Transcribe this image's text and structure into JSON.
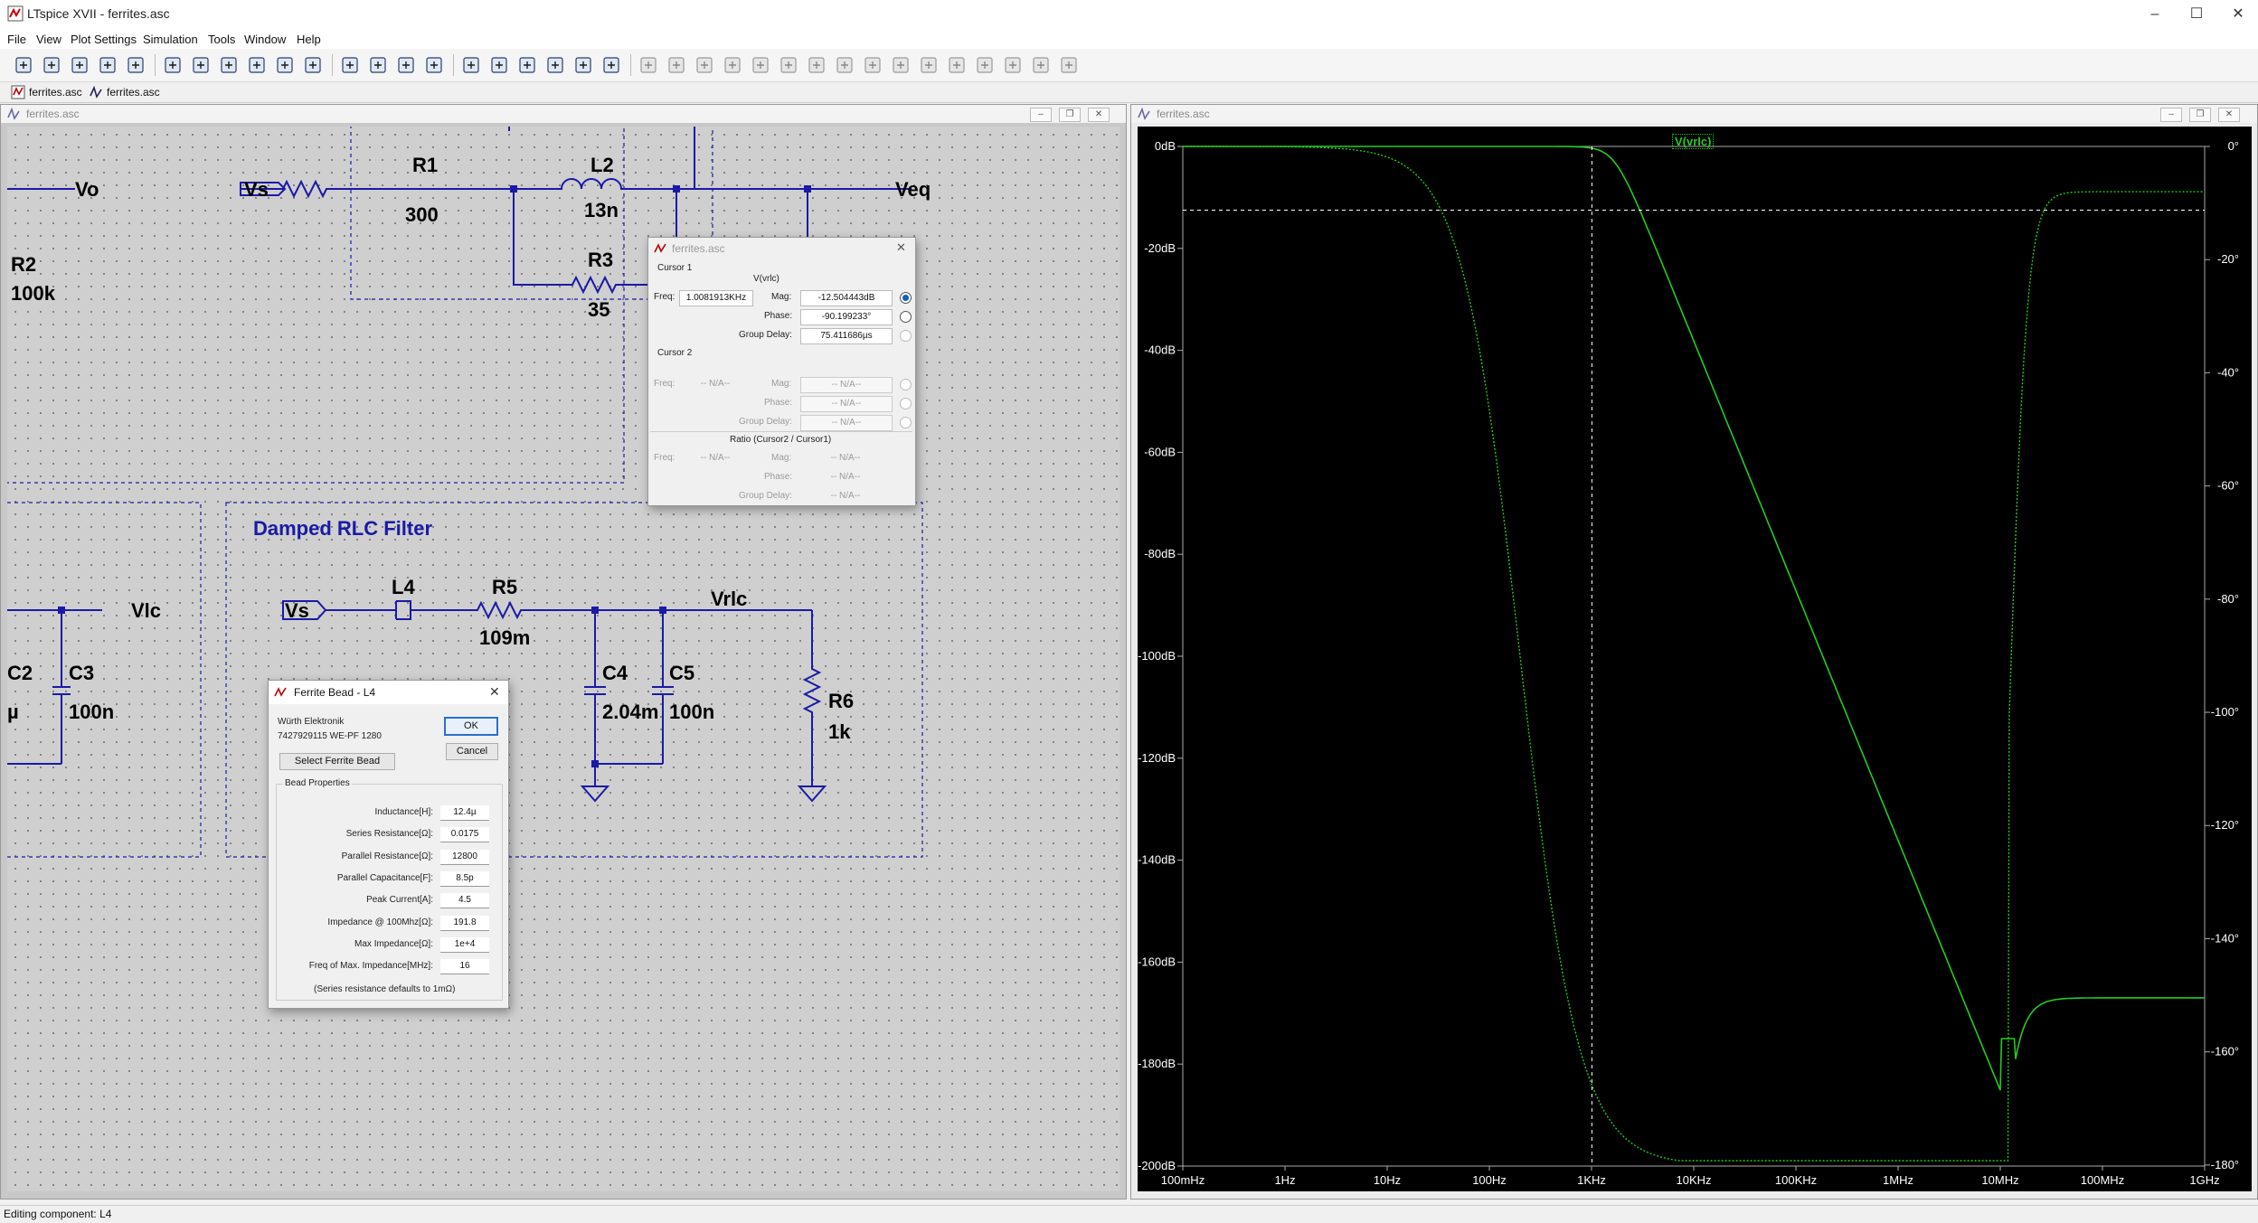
{
  "app": {
    "title": "LTspice XVII - ferrites.asc"
  },
  "window_controls": {
    "minimize": "–",
    "maximize": "☐",
    "close": "✕"
  },
  "menu": [
    "File",
    "View",
    "Plot Settings",
    "Simulation",
    "Tools",
    "Window",
    "Help"
  ],
  "toolbar_icons": [
    "run-icon",
    "open-icon",
    "save-icon",
    "control-panel-icon",
    "halt-icon",
    "pan-icon",
    "zoom-in-icon",
    "zoom-out-icon",
    "zoom-full-icon",
    "zoom-cancel-icon",
    "autorange-icon",
    "grid-icon",
    "tile-horizontal-icon",
    "tile-vertical-icon",
    "cascade-icon",
    "cut-icon",
    "copy-icon",
    "paste-icon",
    "find-icon",
    "print-icon",
    "print-setup-icon",
    "wire-icon",
    "ground-icon",
    "label-icon",
    "resistor-icon",
    "capacitor-icon",
    "inductor-icon",
    "diode-icon",
    "component-icon",
    "move-icon",
    "drag-icon",
    "undo-icon",
    "redo-icon",
    "rotate-icon",
    "mirror-icon",
    "text-icon",
    "spice-directive-icon"
  ],
  "doc_tabs": [
    {
      "label": "ferrites.asc",
      "icon": "schematic-icon"
    },
    {
      "label": "ferrites.asc",
      "icon": "waveform-icon"
    }
  ],
  "schematic": {
    "window_title": "ferrites.asc",
    "labels": {
      "vo": "Vo",
      "vs1": "Vs",
      "r1": "R1",
      "r1v": "300",
      "l2": "L2",
      "l2v": "13n",
      "r3": "R3",
      "r3v": "35",
      "veq": "Veq",
      "r2": "R2",
      "r2v": "100k",
      "heading": "Damped RLC Filter",
      "vs2": "Vs",
      "l4": "L4",
      "r5": "R5",
      "r5v": "109m",
      "vrlc": "Vrlc",
      "vlc": "Vlc",
      "c2": "C2",
      "c2v": "µ",
      "c3": "C3",
      "c3v": "100n",
      "c4": "C4",
      "c4v": "2.04m",
      "c5": "C5",
      "c5v": "100n",
      "r6": "R6",
      "r6v": "1k"
    }
  },
  "cursor_dialog": {
    "title": "ferrites.asc",
    "cursor1_label": "Cursor 1",
    "trace": "V(vrlc)",
    "freq_label": "Freq:",
    "freq": "1.0081913KHz",
    "mag_label": "Mag:",
    "mag": "-12.504443dB",
    "phase_label": "Phase:",
    "phase": "-90.199233°",
    "gd_label": "Group Delay:",
    "gd": "75.411686µs",
    "cursor2_label": "Cursor 2",
    "na": "-- N/A--",
    "ratio_label": "Ratio (Cursor2 / Cursor1)"
  },
  "ferrite_dialog": {
    "title": "Ferrite Bead - L4",
    "manufacturer": "Würth Elektronik",
    "part": "7427929115 WE-PF 1280",
    "ok": "OK",
    "cancel": "Cancel",
    "select_button": "Select Ferrite Bead",
    "group_label": "Bead Properties",
    "properties": [
      {
        "label": "Inductance[H]:",
        "value": "12.4µ"
      },
      {
        "label": "Series Resistance[Ω]:",
        "value": "0.0175"
      },
      {
        "label": "Parallel Resistance[Ω]:",
        "value": "12800"
      },
      {
        "label": "Parallel Capacitance[F]:",
        "value": "8.5p"
      },
      {
        "label": "Peak Current[A]:",
        "value": "4.5"
      },
      {
        "label": "Impedance @ 100Mhz[Ω]:",
        "value": "191.8"
      },
      {
        "label": "Max Impedance[Ω]:",
        "value": "1e+4"
      },
      {
        "label": "Freq of Max. Impedance[MHz]:",
        "value": "16"
      }
    ],
    "note": "(Series resistance defaults to 1mΩ)"
  },
  "plot": {
    "window_title": "ferrites.asc",
    "trace_label": "V(vrlc)",
    "trace_color": "#22cc22",
    "cursor_freq_hz": 1008.19,
    "cursor_mag_db": -12.5,
    "xticks": [
      "100mHz",
      "1Hz",
      "10Hz",
      "100Hz",
      "1KHz",
      "10KHz",
      "100KHz",
      "1MHz",
      "10MHz",
      "100MHz",
      "1GHz"
    ],
    "yticks_left": [
      "0dB",
      "-20dB",
      "-40dB",
      "-60dB",
      "-80dB",
      "-100dB",
      "-120dB",
      "-140dB",
      "-160dB",
      "-180dB",
      "-200dB"
    ],
    "yticks_right": [
      "0°",
      "-20°",
      "-40°",
      "-60°",
      "-80°",
      "-100°",
      "-120°",
      "-140°",
      "-160°",
      "-180°"
    ]
  },
  "status": {
    "text": "Editing component: L4"
  }
}
